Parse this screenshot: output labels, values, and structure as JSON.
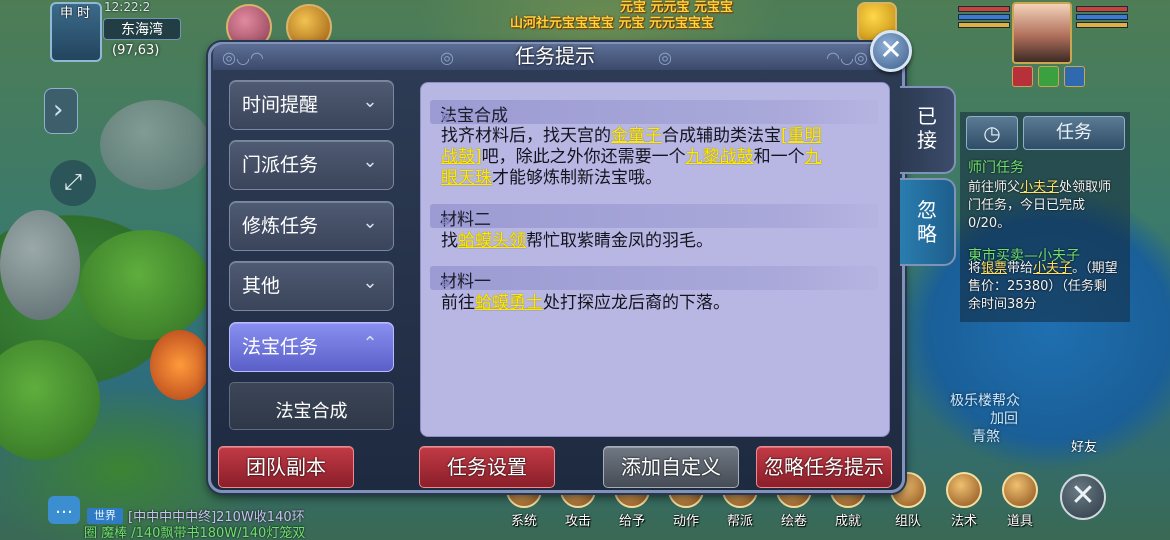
{
  "hud": {
    "time_badge": "申 时",
    "clock": "12:22:2",
    "map_name": "东海湾",
    "coords": "(97,63)",
    "banner_line1": "元宝 元元宝 元宝宝",
    "banner_line2": "山河社元宝宝宝宝 元宝 元元宝宝宝"
  },
  "dialog": {
    "title": "任务提示",
    "categories": [
      {
        "label": "时间提醒",
        "state": "collapsed"
      },
      {
        "label": "门派任务",
        "state": "collapsed"
      },
      {
        "label": "修炼任务",
        "state": "collapsed"
      },
      {
        "label": "其他",
        "state": "collapsed"
      },
      {
        "label": "法宝任务",
        "state": "expanded"
      }
    ],
    "sub_item": "法宝合成",
    "sections": [
      {
        "heading": "法宝合成",
        "parts": [
          "找齐材料后，找天宫的",
          "金童子",
          "合成辅助类法宝",
          "[重明",
          "战鼓]",
          "吧，除此之外你还需要一个",
          "九黎战鼓",
          "和一个",
          "九",
          "眼天珠",
          "才能够炼制新法宝哦。"
        ]
      },
      {
        "heading": "材料二",
        "parts": [
          "找",
          "蛤蟆头领",
          "帮忙取紫睛金凤的羽毛。"
        ]
      },
      {
        "heading": "材料一",
        "parts": [
          "前往",
          "蛤蟆勇士",
          "处打探应龙后裔的下落。"
        ]
      }
    ],
    "buttons": {
      "team_dungeon": "团队副本",
      "task_settings": "任务设置",
      "add_custom": "添加自定义",
      "ignore_prompt": "忽略任务提示"
    },
    "side_tabs": {
      "accepted": [
        "已",
        "接"
      ],
      "ignored": [
        "忽",
        "略"
      ]
    }
  },
  "task_tracker": {
    "tab_label": "任务",
    "items": [
      {
        "title": "师门任务",
        "text_a": "前往师父",
        "npc": "小夫子",
        "text_b": "处领取师门任务，今日已完成0/20。"
      },
      {
        "title": "東市买卖—小夫子",
        "text_a": "将",
        "npc": "银票",
        "text_b": "带给",
        "npc2": "小夫子",
        "text_c": "。（期望售价：25380）（任务剩余时间38分"
      }
    ]
  },
  "float_text": [
    "极乐楼帮众",
    "加回",
    "青煞"
  ],
  "friend_label": "好友",
  "chat": {
    "channel": "世界",
    "line1": "[中中中中中终]210W收140环",
    "line2": "圈 魔棒 /140飘带书180W/140灯笼双"
  },
  "menu": [
    "系统",
    "攻击",
    "给予",
    "动作",
    "帮派",
    "绘卷",
    "成就",
    "组队",
    "法术",
    "道具"
  ],
  "colors": {
    "accent_active": "#7a80e6",
    "highlight_text": "#ffe900",
    "button_red": "#a82c37",
    "content_bg": "#b8b7e3"
  }
}
